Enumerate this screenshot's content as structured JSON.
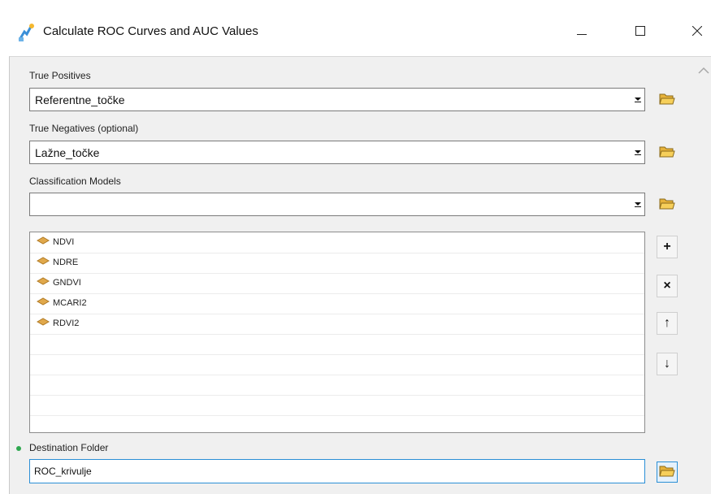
{
  "window": {
    "title": "Calculate ROC Curves and AUC Values",
    "icon": "geoprocessing-tool-icon",
    "controls": [
      "minimize-icon",
      "maximize-icon",
      "close-icon"
    ]
  },
  "form": {
    "true_positives": {
      "label": "True Positives",
      "value": "Referentne_točke"
    },
    "true_negatives": {
      "label": "True Negatives (optional)",
      "value": "Lažne_točke"
    },
    "classification_models": {
      "label": "Classification Models",
      "value": "",
      "items": [
        "NDVI",
        "NDRE",
        "GNDVI",
        "MCARI2",
        "RDVI2"
      ]
    },
    "destination_folder": {
      "label": "Destination Folder",
      "value": "ROC_krivulje",
      "required": true
    }
  },
  "list_buttons": {
    "add": "+",
    "remove": "×",
    "up": "↑",
    "down": "↓"
  },
  "colors": {
    "required_marker": "#2fa84f",
    "layer_icon": "#e0a84b",
    "folder_icon": "#f0c24a",
    "focus_border": "#2a8fd6"
  }
}
